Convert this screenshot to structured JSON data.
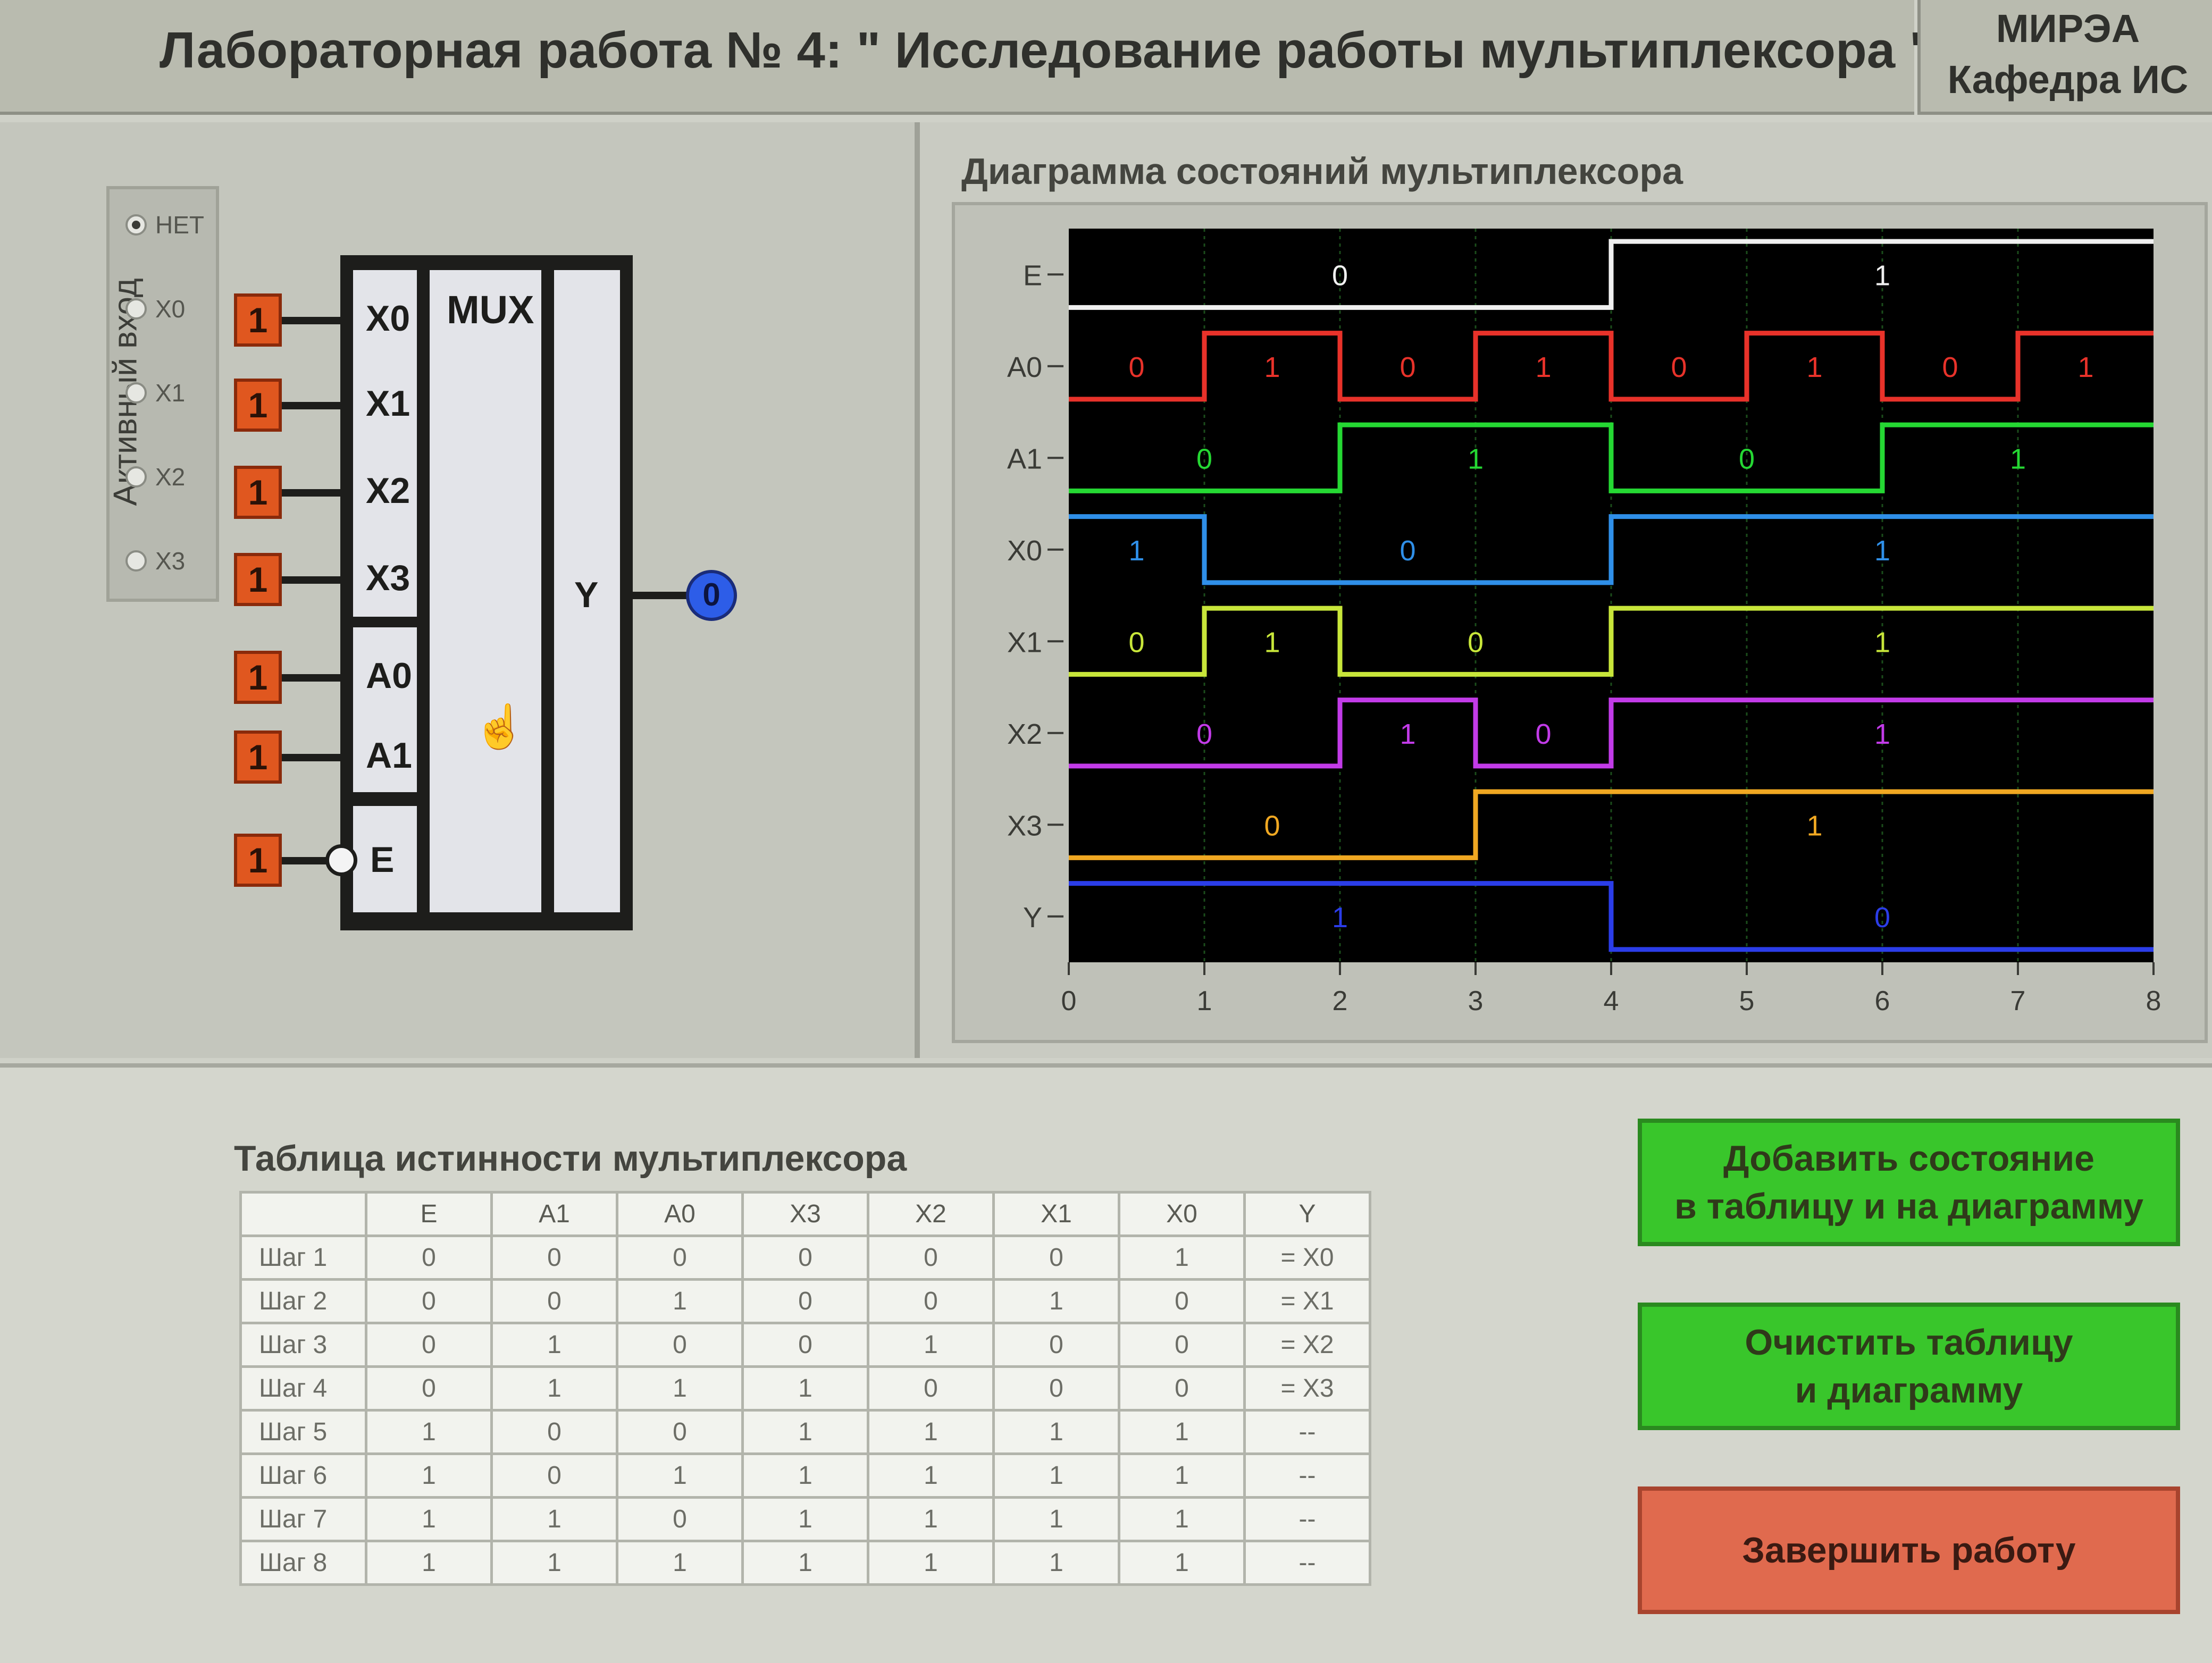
{
  "header": {
    "title": "Лабораторная работа № 4: \" Исследование работы мультиплексора \"",
    "org_line1": "МИРЭА",
    "org_line2": "Кафедра ИС"
  },
  "active_input": {
    "label": "Активный вход",
    "options": [
      "НЕТ",
      "X0",
      "X1",
      "X2",
      "X3"
    ],
    "selected": "НЕТ"
  },
  "mux": {
    "block_label": "MUX",
    "data_pins": [
      "X0",
      "X1",
      "X2",
      "X3"
    ],
    "address_pins": [
      "A0",
      "A1"
    ],
    "enable_pin": "E",
    "output_pin": "Y",
    "input_values": [
      "1",
      "1",
      "1",
      "1",
      "1",
      "1",
      "1"
    ],
    "output_value": "0",
    "colors": {
      "input_button": "#e0571f",
      "output_led": "#2d5de8"
    }
  },
  "chart_data": {
    "type": "line",
    "title": "Диаграмма состояний мультиплексора",
    "x_ticks": [
      "0",
      "1",
      "2",
      "3",
      "4",
      "5",
      "6",
      "7",
      "8"
    ],
    "xlim": [
      0,
      8
    ],
    "signals": [
      {
        "name": "E",
        "color": "#f0f0f0",
        "values": [
          0,
          0,
          0,
          0,
          1,
          1,
          1,
          1
        ],
        "labels": [
          "0",
          "1"
        ]
      },
      {
        "name": "A0",
        "color": "#e8322a",
        "values": [
          0,
          1,
          0,
          1,
          0,
          1,
          0,
          1
        ],
        "labels": [
          "0",
          "1",
          "0",
          "1",
          "0",
          "1",
          "0",
          "1"
        ]
      },
      {
        "name": "A1",
        "color": "#25d833",
        "values": [
          0,
          0,
          1,
          1,
          0,
          0,
          1,
          1
        ],
        "labels": [
          "0",
          "1",
          "0",
          "1"
        ]
      },
      {
        "name": "X0",
        "color": "#2f8fe8",
        "values": [
          1,
          0,
          0,
          0,
          1,
          1,
          1,
          1
        ],
        "labels": [
          "1",
          "0",
          "1"
        ]
      },
      {
        "name": "X1",
        "color": "#c8e63a",
        "values": [
          0,
          1,
          0,
          0,
          1,
          1,
          1,
          1
        ],
        "labels": [
          "0",
          "1",
          "0",
          "1"
        ]
      },
      {
        "name": "X2",
        "color": "#c23be8",
        "values": [
          0,
          0,
          1,
          0,
          1,
          1,
          1,
          1
        ],
        "labels": [
          "0",
          "1",
          "0",
          "1"
        ]
      },
      {
        "name": "X3",
        "color": "#f0a822",
        "values": [
          0,
          0,
          0,
          1,
          1,
          1,
          1,
          1
        ],
        "labels": [
          "0",
          "1"
        ]
      },
      {
        "name": "Y",
        "color": "#2b3de8",
        "values": [
          1,
          1,
          1,
          1,
          0,
          0,
          0,
          0
        ],
        "labels": [
          "1",
          "0"
        ]
      }
    ],
    "grid": true,
    "background": "#000000"
  },
  "truth_table": {
    "title": "Таблица истинности мультиплексора",
    "headers": [
      "",
      "E",
      "A1",
      "A0",
      "X3",
      "X2",
      "X1",
      "X0",
      "Y"
    ],
    "rows": [
      [
        "Шаг 1",
        "0",
        "0",
        "0",
        "0",
        "0",
        "0",
        "1",
        "= X0"
      ],
      [
        "Шаг 2",
        "0",
        "0",
        "1",
        "0",
        "0",
        "1",
        "0",
        "= X1"
      ],
      [
        "Шаг 3",
        "0",
        "1",
        "0",
        "0",
        "1",
        "0",
        "0",
        "= X2"
      ],
      [
        "Шаг 4",
        "0",
        "1",
        "1",
        "1",
        "0",
        "0",
        "0",
        "= X3"
      ],
      [
        "Шаг 5",
        "1",
        "0",
        "0",
        "1",
        "1",
        "1",
        "1",
        "--"
      ],
      [
        "Шаг 6",
        "1",
        "0",
        "1",
        "1",
        "1",
        "1",
        "1",
        "--"
      ],
      [
        "Шаг 7",
        "1",
        "1",
        "0",
        "1",
        "1",
        "1",
        "1",
        "--"
      ],
      [
        "Шаг 8",
        "1",
        "1",
        "1",
        "1",
        "1",
        "1",
        "1",
        "--"
      ]
    ]
  },
  "buttons": {
    "add": "Добавить состояние\nв таблицу и на диаграмму",
    "clear": "Очистить таблицу\nи диаграмму",
    "finish": "Завершить работу"
  }
}
